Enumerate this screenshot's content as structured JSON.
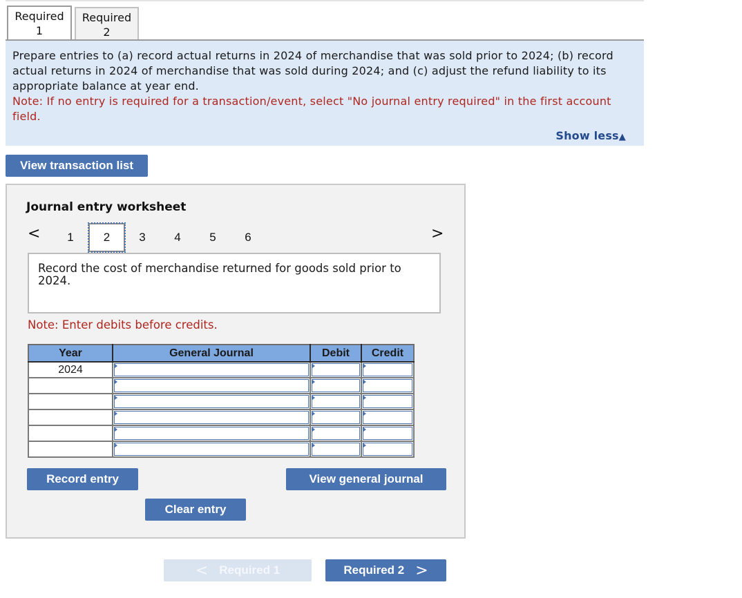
{
  "tabs": [
    {
      "line1": "Required",
      "line2": "1",
      "active": true
    },
    {
      "line1": "Required",
      "line2": "2",
      "active": false
    }
  ],
  "instructions": {
    "text": "Prepare entries to (a) record actual returns in 2024 of merchandise that was sold prior to 2024; (b) record actual returns in 2024 of merchandise that was sold during 2024; and (c) adjust the refund liability to its appropriate balance at year end.",
    "note": "Note: If no entry is required for a transaction/event, select \"No journal entry required\" in the first account field.",
    "show_less_label": "Show less",
    "show_less_icon": "▲"
  },
  "view_transaction_list_label": "View transaction list",
  "worksheet": {
    "title": "Journal entry worksheet",
    "pager": {
      "prev_icon": "<",
      "next_icon": ">",
      "pages": [
        "1",
        "2",
        "3",
        "4",
        "5",
        "6"
      ],
      "current_page": "2"
    },
    "description": "Record the cost of merchandise returned for goods sold prior to 2024.",
    "note": "Note: Enter debits before credits.",
    "table": {
      "headers": [
        "Year",
        "General Journal",
        "Debit",
        "Credit"
      ],
      "rows": [
        {
          "year": "2024",
          "account": "",
          "debit": "",
          "credit": ""
        },
        {
          "year": "",
          "account": "",
          "debit": "",
          "credit": ""
        },
        {
          "year": "",
          "account": "",
          "debit": "",
          "credit": ""
        },
        {
          "year": "",
          "account": "",
          "debit": "",
          "credit": ""
        },
        {
          "year": "",
          "account": "",
          "debit": "",
          "credit": ""
        },
        {
          "year": "",
          "account": "",
          "debit": "",
          "credit": ""
        }
      ]
    },
    "buttons": {
      "record": "Record entry",
      "clear": "Clear entry",
      "view_general_journal": "View general journal"
    }
  },
  "nav": {
    "prev_label": "Required 1",
    "prev_icon": "<",
    "next_label": "Required 2",
    "next_icon": ">"
  },
  "colors": {
    "accent": "#4a73b1",
    "instruction_bg": "#dde9f7",
    "note_red": "#b0261f",
    "table_header_bg": "#7ea8e0",
    "worksheet_bg": "#f2f2f2"
  }
}
